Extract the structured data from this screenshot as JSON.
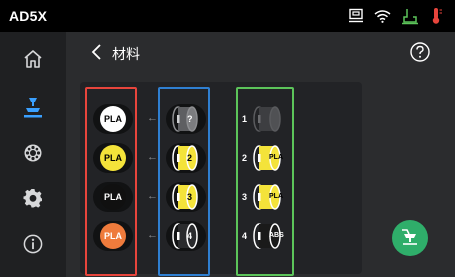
{
  "app": {
    "title": "AD5X"
  },
  "page": {
    "title": "材料"
  },
  "icons": {
    "status": [
      "printer-icon",
      "wifi-icon",
      "print-job-icon",
      "thermometer-icon"
    ],
    "sidebar": [
      "home-icon",
      "print-icon",
      "material-icon",
      "settings-icon",
      "info-icon"
    ]
  },
  "colors": {
    "accent_green": "#2fae6a",
    "outline_red": "#e8453c",
    "outline_blue": "#2f7fd1",
    "outline_green": "#5cc45a",
    "active_blue": "#3aa0ff"
  },
  "materials": [
    {
      "label": "PLA",
      "color": "#ffffff",
      "text_color": "#000000"
    },
    {
      "label": "PLA",
      "color": "#f4e33a",
      "text_color": "#000000"
    },
    {
      "label": "PLA",
      "color": "#101010",
      "text_color": "#ffffff"
    },
    {
      "label": "PLA",
      "color": "#ef7b3c",
      "text_color": "#ffffff"
    }
  ],
  "arrow": "←",
  "mapped_spools": [
    {
      "label": "?",
      "color": "#6a6b6e"
    },
    {
      "label": "2",
      "color": "#f4e33a"
    },
    {
      "label": "3",
      "color": "#f4e33a"
    },
    {
      "label": "4",
      "color": "#2a2b2d"
    }
  ],
  "slots": [
    {
      "number": "1",
      "label": "",
      "color": "#5a5b5e"
    },
    {
      "number": "2",
      "label": "PLA",
      "color": "#f4e33a"
    },
    {
      "number": "3",
      "label": "PLA",
      "color": "#f4e33a"
    },
    {
      "number": "4",
      "label": "ABS",
      "color": "#1a1a1a"
    }
  ]
}
